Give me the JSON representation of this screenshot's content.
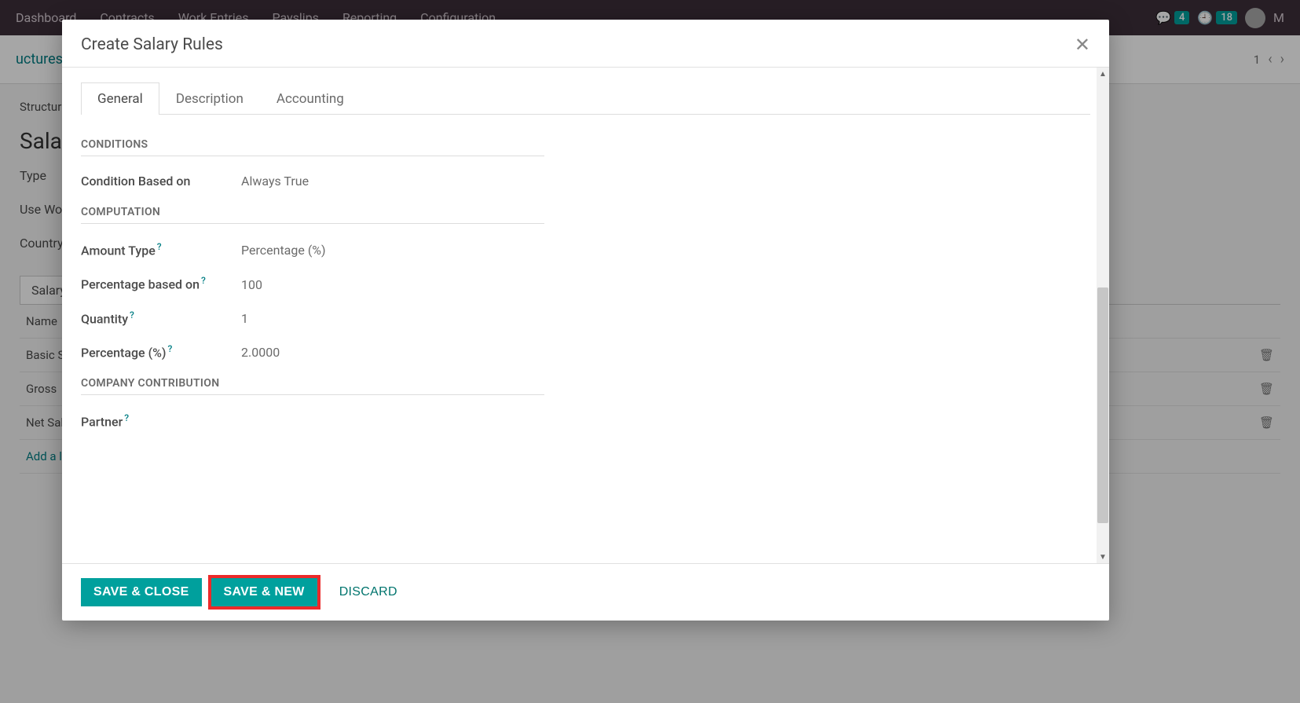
{
  "nav": {
    "items": [
      "Dashboard",
      "Contracts",
      "Work Entries",
      "Payslips",
      "Reporting",
      "Configuration"
    ],
    "msg_count": "4",
    "clock_count": "18",
    "user_initial": "M"
  },
  "bg": {
    "breadcrumb": "uctures",
    "pager": "1",
    "structure_lbl": "Structur",
    "title": "Sala",
    "type_lbl": "Type",
    "usewor_lbl": "Use Wor",
    "country_lbl": "Country",
    "tab_salary": "Salary",
    "col_name": "Name",
    "rows": [
      "Basic Sa",
      "Gross",
      "Net Sala"
    ],
    "addline": "Add a lin"
  },
  "modal": {
    "title": "Create Salary Rules",
    "tabs": {
      "general": "General",
      "description": "Description",
      "accounting": "Accounting"
    },
    "sections": {
      "conditions": "CONDITIONS",
      "computation": "COMPUTATION",
      "company_contribution": "COMPANY CONTRIBUTION"
    },
    "fields": {
      "condition_based_on": {
        "label": "Condition Based on",
        "value": "Always True"
      },
      "amount_type": {
        "label": "Amount Type",
        "value": "Percentage (%)"
      },
      "percentage_based_on": {
        "label": "Percentage based on",
        "value": "100"
      },
      "quantity": {
        "label": "Quantity",
        "value": "1"
      },
      "percentage": {
        "label": "Percentage (%)",
        "value": "2.0000"
      },
      "partner": {
        "label": "Partner",
        "value": ""
      }
    },
    "buttons": {
      "save_close": "SAVE & CLOSE",
      "save_new": "SAVE & NEW",
      "discard": "DISCARD"
    }
  }
}
